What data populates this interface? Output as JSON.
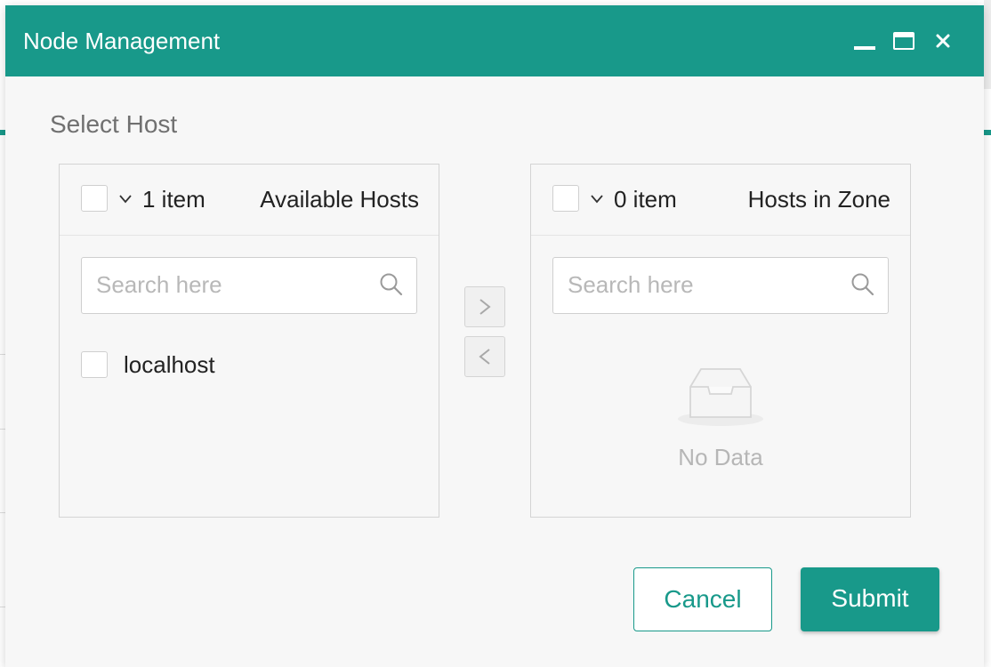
{
  "modal": {
    "title": "Node Management",
    "section_label": "Select Host"
  },
  "left_panel": {
    "count": "1 item",
    "title": "Available Hosts",
    "search_placeholder": "Search here",
    "items": [
      {
        "label": "localhost",
        "checked": false
      }
    ]
  },
  "right_panel": {
    "count": "0 item",
    "title": "Hosts in Zone",
    "search_placeholder": "Search here",
    "empty_text": "No Data"
  },
  "footer": {
    "cancel_label": "Cancel",
    "submit_label": "Submit"
  },
  "colors": {
    "accent": "#18998a",
    "background": "#f7f7f7",
    "border": "#d4d4d4",
    "placeholder": "#b8b8b8"
  },
  "icons": {
    "minimize": "minimize-icon",
    "maximize": "maximize-icon",
    "close": "close-icon",
    "search": "search-icon",
    "chevron": "chevron-down-icon",
    "transfer_right": "chevron-right-icon",
    "transfer_left": "chevron-left-icon",
    "empty": "empty-inbox-icon"
  }
}
